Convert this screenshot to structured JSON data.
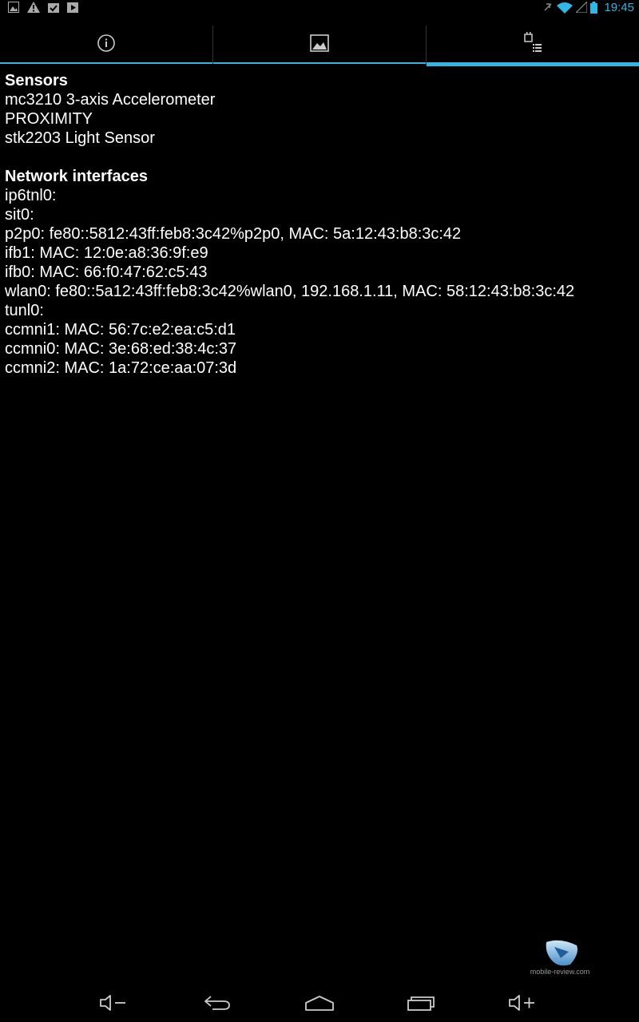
{
  "status_bar": {
    "time": "19:45",
    "left_icons": [
      "image-icon",
      "warning-icon",
      "checklist-icon",
      "play-icon"
    ],
    "right_icons": [
      "mute-icon",
      "wifi-icon",
      "signal-icon",
      "battery-icon"
    ],
    "accent_color": "#33b5e5"
  },
  "tabs": [
    {
      "icon": "info-icon",
      "selected": false
    },
    {
      "icon": "image-icon",
      "selected": false
    },
    {
      "icon": "device-list-icon",
      "selected": true
    }
  ],
  "sensors": {
    "heading": "Sensors",
    "items": [
      "mc3210 3-axis Accelerometer",
      "PROXIMITY",
      "stk2203 Light Sensor"
    ]
  },
  "network": {
    "heading": "Network interfaces",
    "items": [
      "ip6tnl0:",
      "sit0:",
      "p2p0: fe80::5812:43ff:feb8:3c42%p2p0, MAC: 5a:12:43:b8:3c:42",
      "ifb1: MAC: 12:0e:a8:36:9f:e9",
      "ifb0: MAC: 66:f0:47:62:c5:43",
      "wlan0: fe80::5a12:43ff:feb8:3c42%wlan0, 192.168.1.11, MAC: 58:12:43:b8:3c:42",
      "tunl0:",
      "ccmni1: MAC: 56:7c:e2:ea:c5:d1",
      "ccmni0: MAC: 3e:68:ed:38:4c:37",
      "ccmni2: MAC: 1a:72:ce:aa:07:3d"
    ]
  },
  "watermark": {
    "text": "mobile-review.com"
  },
  "nav_bar": {
    "buttons": [
      "volume-down-icon",
      "back-icon",
      "home-icon",
      "recent-apps-icon",
      "volume-up-icon"
    ]
  }
}
